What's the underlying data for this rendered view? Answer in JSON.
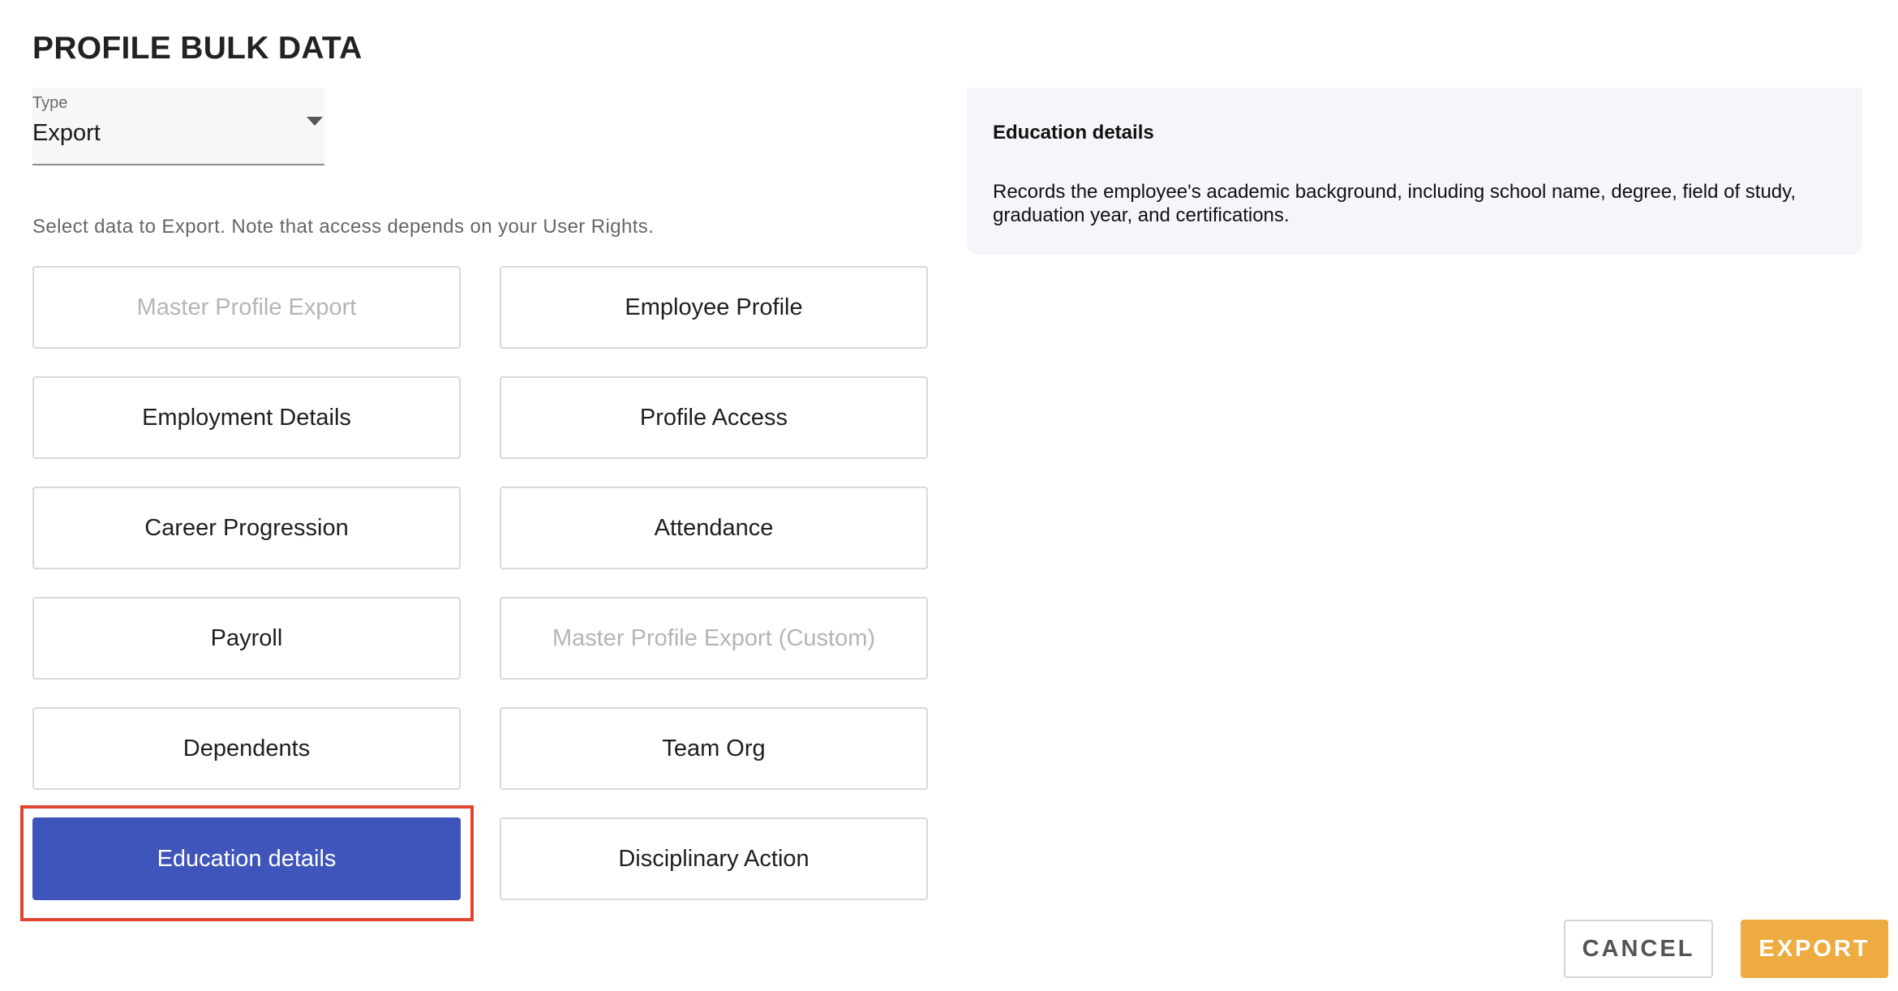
{
  "page": {
    "title": "PROFILE BULK DATA",
    "hint": "Select data to Export. Note that access depends on your User Rights."
  },
  "type_select": {
    "label": "Type",
    "value": "Export"
  },
  "options": [
    {
      "label": "Master Profile Export",
      "state": "disabled"
    },
    {
      "label": "Employee Profile",
      "state": "enabled"
    },
    {
      "label": "Employment Details",
      "state": "enabled"
    },
    {
      "label": "Profile Access",
      "state": "enabled"
    },
    {
      "label": "Career Progression",
      "state": "enabled"
    },
    {
      "label": "Attendance",
      "state": "enabled"
    },
    {
      "label": "Payroll",
      "state": "enabled"
    },
    {
      "label": "Master Profile Export (Custom)",
      "state": "disabled"
    },
    {
      "label": "Dependents",
      "state": "enabled"
    },
    {
      "label": "Team Org",
      "state": "enabled"
    },
    {
      "label": "Education details",
      "state": "selected"
    },
    {
      "label": "Disciplinary Action",
      "state": "enabled"
    }
  ],
  "description": {
    "title": "Education details",
    "text": "Records the employee's academic background, including school name, degree, field of study, graduation year, and certifications."
  },
  "footer": {
    "cancel_label": "CANCEL",
    "export_label": "EXPORT"
  },
  "colors": {
    "selected": "#3f55bc",
    "highlight": "#e0442e",
    "export": "#eeab3f",
    "panel": "#f5f6fa"
  },
  "icons": {
    "type_caret": "caret-down-icon"
  }
}
